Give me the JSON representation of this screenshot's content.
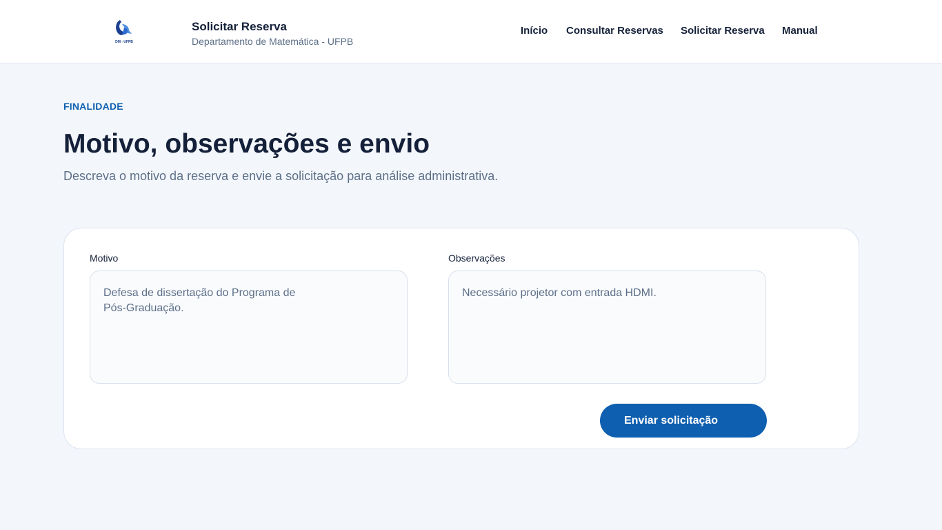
{
  "header": {
    "logo_text": "DM - UFPB",
    "title": "Solicitar Reserva",
    "subtitle": "Departamento de Matemática - UFPB",
    "nav": [
      {
        "label": "Início"
      },
      {
        "label": "Consultar Reservas"
      },
      {
        "label": "Solicitar Reserva"
      },
      {
        "label": "Manual"
      }
    ]
  },
  "main": {
    "eyebrow": "FINALIDADE",
    "title": "Motivo, observações e envio",
    "subtitle": "Descreva o motivo da reserva e envie a solicitação para análise administrativa."
  },
  "form": {
    "motivo_label": "Motivo",
    "motivo_value": "Defesa de dissertação do Programa de\nPós-Graduação.",
    "observacoes_label": "Observações",
    "observacoes_value": "Necessário projetor com entrada HDMI.",
    "submit_label": "Enviar solicitação"
  },
  "colors": {
    "accent": "#0e5fb0",
    "text_dark": "#142039",
    "text_muted": "#5d6f88",
    "page_bg": "#f3f7fb"
  }
}
